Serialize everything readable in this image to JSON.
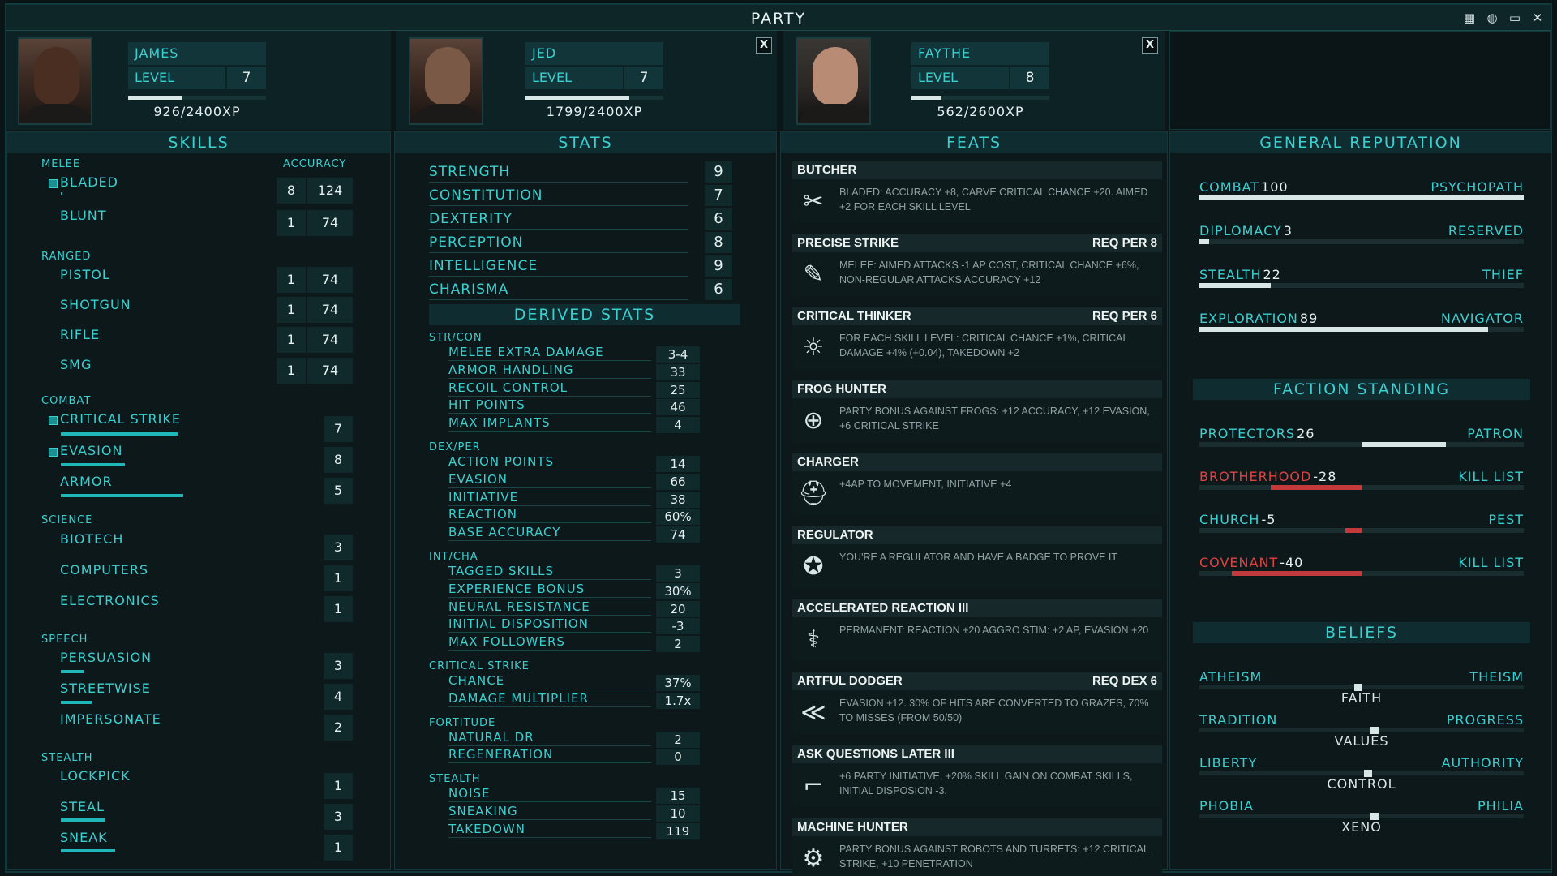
{
  "window": {
    "title": "PARTY"
  },
  "characters": [
    {
      "name": "JAMES",
      "level_label": "LEVEL",
      "level": "7",
      "xp": "926/2400XP",
      "xp_fraction": 0.386,
      "closable": false
    },
    {
      "name": "JED",
      "level_label": "LEVEL",
      "level": "7",
      "xp": "1799/2400XP",
      "xp_fraction": 0.75,
      "closable": true,
      "close_label": "X"
    },
    {
      "name": "FAYTHE",
      "level_label": "LEVEL",
      "level": "8",
      "xp": "562/2600XP",
      "xp_fraction": 0.216,
      "closable": true,
      "close_label": "X"
    }
  ],
  "skills": {
    "header": "SKILLS",
    "accuracy_label": "ACCURACY",
    "melee_label": "MELEE",
    "ranged_label": "RANGED",
    "combat_label": "COMBAT",
    "science_label": "SCIENCE",
    "speech_label": "SPEECH",
    "stealth_label": "STEALTH",
    "melee": [
      {
        "name": "BLADED",
        "value": "8",
        "accuracy": "124",
        "tagged": true,
        "progress": 0.01
      },
      {
        "name": "BLUNT",
        "value": "1",
        "accuracy": "74",
        "tagged": false,
        "progress": 0
      }
    ],
    "ranged": [
      {
        "name": "PISTOL",
        "value": "1",
        "accuracy": "74"
      },
      {
        "name": "SHOTGUN",
        "value": "1",
        "accuracy": "74"
      },
      {
        "name": "RIFLE",
        "value": "1",
        "accuracy": "74"
      },
      {
        "name": "SMG",
        "value": "1",
        "accuracy": "74"
      }
    ],
    "combat": [
      {
        "name": "CRITICAL STRIKE",
        "value": "7",
        "tagged": true,
        "progress": 0.6
      },
      {
        "name": "EVASION",
        "value": "8",
        "tagged": true,
        "progress": 0.33
      },
      {
        "name": "ARMOR",
        "value": "5",
        "tagged": false,
        "progress": 0.63
      }
    ],
    "science": [
      {
        "name": "BIOTECH",
        "value": "3",
        "progress": 0
      },
      {
        "name": "COMPUTERS",
        "value": "1",
        "progress": 0
      },
      {
        "name": "ELECTRONICS",
        "value": "1",
        "progress": 0
      }
    ],
    "speech": [
      {
        "name": "PERSUASION",
        "value": "3",
        "progress": 0.12
      },
      {
        "name": "STREETWISE",
        "value": "4",
        "progress": 0.16
      },
      {
        "name": "IMPERSONATE",
        "value": "2",
        "progress": 0
      }
    ],
    "stealth": [
      {
        "name": "LOCKPICK",
        "value": "1",
        "progress": 0
      },
      {
        "name": "STEAL",
        "value": "3",
        "progress": 0.23
      },
      {
        "name": "SNEAK",
        "value": "1",
        "progress": 0.28
      }
    ]
  },
  "stats": {
    "header": "STATS",
    "primary": [
      {
        "name": "STRENGTH",
        "value": "9"
      },
      {
        "name": "CONSTITUTION",
        "value": "7"
      },
      {
        "name": "DEXTERITY",
        "value": "6"
      },
      {
        "name": "PERCEPTION",
        "value": "8"
      },
      {
        "name": "INTELLIGENCE",
        "value": "9"
      },
      {
        "name": "CHARISMA",
        "value": "6"
      }
    ],
    "derived_header": "DERIVED STATS",
    "groups": [
      {
        "label": "STR/CON",
        "rows": [
          {
            "name": "MELEE EXTRA DAMAGE",
            "value": "3-4"
          },
          {
            "name": "ARMOR HANDLING",
            "value": "33"
          },
          {
            "name": "RECOIL CONTROL",
            "value": "25"
          },
          {
            "name": "HIT POINTS",
            "value": "46"
          },
          {
            "name": "MAX IMPLANTS",
            "value": "4"
          }
        ]
      },
      {
        "label": "DEX/PER",
        "rows": [
          {
            "name": "ACTION POINTS",
            "value": "14"
          },
          {
            "name": "EVASION",
            "value": "66"
          },
          {
            "name": "INITIATIVE",
            "value": "38"
          },
          {
            "name": "REACTION",
            "value": "60%"
          },
          {
            "name": "BASE ACCURACY",
            "value": "74"
          }
        ]
      },
      {
        "label": "INT/CHA",
        "rows": [
          {
            "name": "TAGGED SKILLS",
            "value": "3"
          },
          {
            "name": "EXPERIENCE BONUS",
            "value": "30%"
          },
          {
            "name": "NEURAL RESISTANCE",
            "value": "20"
          },
          {
            "name": "INITIAL DISPOSITION",
            "value": "-3"
          },
          {
            "name": "MAX FOLLOWERS",
            "value": "2"
          }
        ]
      },
      {
        "label": "CRITICAL STRIKE",
        "rows": [
          {
            "name": "CHANCE",
            "value": "37%"
          },
          {
            "name": "DAMAGE MULTIPLIER",
            "value": "1.7x"
          }
        ]
      },
      {
        "label": "FORTITUDE",
        "rows": [
          {
            "name": "NATURAL DR",
            "value": "2"
          },
          {
            "name": "REGENERATION",
            "value": "0"
          }
        ]
      },
      {
        "label": "STEALTH",
        "rows": [
          {
            "name": "NOISE",
            "value": "15"
          },
          {
            "name": "SNEAKING",
            "value": "10"
          },
          {
            "name": "TAKEDOWN",
            "value": "119"
          }
        ]
      }
    ]
  },
  "feats": {
    "header": "FEATS",
    "items": [
      {
        "name": "BUTCHER",
        "req": "",
        "icon": "✂",
        "icon_name": "crossed-blades-icon",
        "desc": "BLADED: ACCURACY +8, CARVE CRITICAL CHANCE +20. AIMED +2 FOR EACH SKILL LEVEL"
      },
      {
        "name": "PRECISE STRIKE",
        "req": "REQ PER 8",
        "icon": "✎",
        "icon_name": "blade-target-icon",
        "desc": "MELEE: AIMED ATTACKS -1 AP COST, CRITICAL CHANCE +6%, NON-REGULAR ATTACKS ACCURACY +12"
      },
      {
        "name": "CRITICAL THINKER",
        "req": "REQ PER 6",
        "icon": "☼",
        "icon_name": "lightbulb-icon",
        "desc": "FOR EACH SKILL LEVEL: CRITICAL CHANCE +1%, CRITICAL DAMAGE +4% (+0.04), TAKEDOWN +2"
      },
      {
        "name": "FROG HUNTER",
        "req": "",
        "icon": "⊕",
        "icon_name": "frog-target-icon",
        "desc": "PARTY BONUS AGAINST FROGS: +12 ACCURACY, +12 EVASION, +6 CRITICAL STRIKE"
      },
      {
        "name": "CHARGER",
        "req": "",
        "icon": "⛑",
        "icon_name": "helmet-icon",
        "desc": "+4AP TO MOVEMENT, INITIATIVE +4"
      },
      {
        "name": "REGULATOR",
        "req": "",
        "icon": "✪",
        "icon_name": "badge-star-icon",
        "desc": "YOU'RE A REGULATOR AND HAVE A BADGE TO PROVE IT"
      },
      {
        "name": "ACCELERATED REACTION III",
        "req": "",
        "icon": "⚕",
        "icon_name": "dna-icon",
        "desc": "PERMANENT: REACTION +20 AGGRO STIM: +2 AP, EVASION +20"
      },
      {
        "name": "ARTFUL DODGER",
        "req": "REQ DEX 6",
        "icon": "≪",
        "icon_name": "dodge-arrows-icon",
        "desc": "EVASION +12. 30% OF HITS ARE CONVERTED TO GRAZES, 70% TO MISSES (FROM 50/50)"
      },
      {
        "name": "ASK QUESTIONS LATER III",
        "req": "",
        "icon": "⌐",
        "icon_name": "gun-icon",
        "desc": "+6 PARTY INITIATIVE, +20% SKILL GAIN ON COMBAT SKILLS, INITIAL DISPOSION -3."
      },
      {
        "name": "MACHINE HUNTER",
        "req": "",
        "icon": "⚙",
        "icon_name": "robot-target-icon",
        "desc": "PARTY BONUS AGAINST ROBOTS AND TURRETS: +12 CRITICAL STRIKE, +10 PENETRATION"
      }
    ]
  },
  "reputation": {
    "header": "GENERAL REPUTATION",
    "general": [
      {
        "name": "COMBAT",
        "value": "100",
        "title": "PSYCHOPATH",
        "fraction": 1.0
      },
      {
        "name": "DIPLOMACY",
        "value": "3",
        "title": "RESERVED",
        "fraction": 0.03
      },
      {
        "name": "STEALTH",
        "value": "22",
        "title": "THIEF",
        "fraction": 0.22
      },
      {
        "name": "EXPLORATION",
        "value": "89",
        "title": "NAVIGATOR",
        "fraction": 0.89
      }
    ],
    "faction_header": "FACTION STANDING",
    "factions": [
      {
        "name": "PROTECTORS",
        "value": "26",
        "title": "PATRON",
        "standing": 26,
        "red": false
      },
      {
        "name": "BROTHERHOOD",
        "value": "-28",
        "title": "KILL LIST",
        "standing": -28,
        "red": true
      },
      {
        "name": "CHURCH",
        "value": "-5",
        "title": "PEST",
        "standing": -5,
        "red": false
      },
      {
        "name": "COVENANT",
        "value": "-40",
        "title": "KILL LIST",
        "standing": -40,
        "red": true
      }
    ],
    "beliefs_header": "BELIEFS",
    "beliefs": [
      {
        "left": "ATHEISM",
        "right": "THEISM",
        "center": "FAITH",
        "position": 0.49
      },
      {
        "left": "TRADITION",
        "right": "PROGRESS",
        "center": "VALUES",
        "position": 0.54
      },
      {
        "left": "LIBERTY",
        "right": "AUTHORITY",
        "center": "CONTROL",
        "position": 0.52
      },
      {
        "left": "PHOBIA",
        "right": "PHILIA",
        "center": "XENO",
        "position": 0.54
      }
    ]
  }
}
